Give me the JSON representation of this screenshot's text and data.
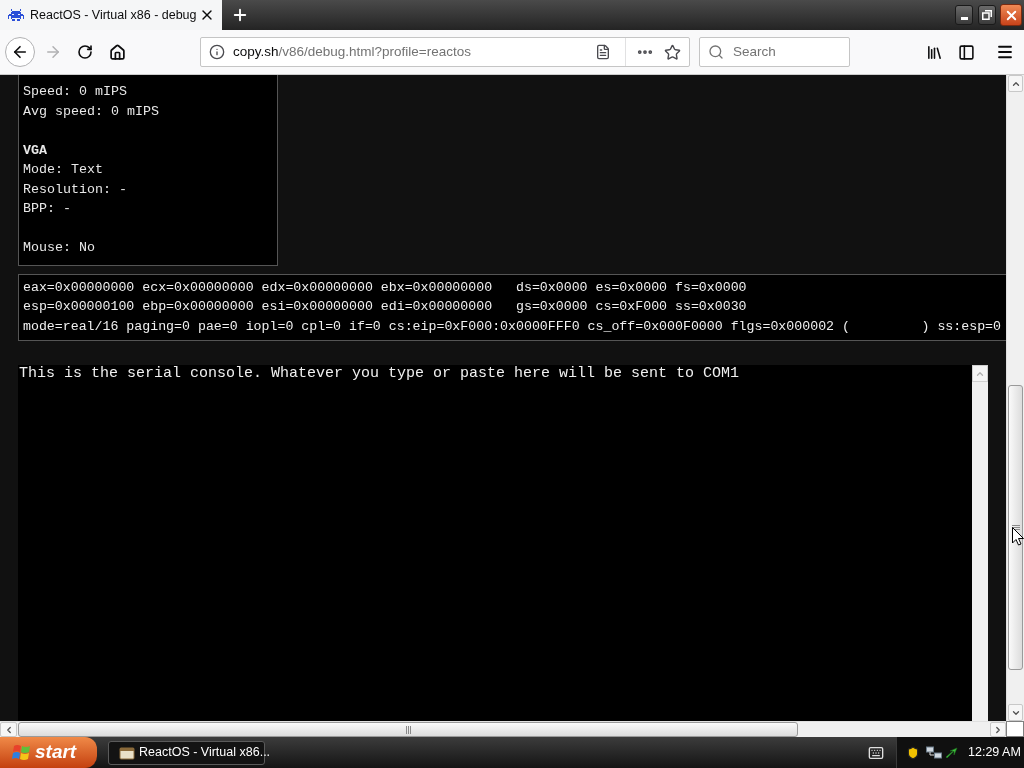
{
  "browser": {
    "tabs": [
      {
        "title": "ReactOS - Virtual x86 - debug",
        "selected": true
      }
    ],
    "back": {
      "disabled": false
    },
    "forward": {
      "disabled": true
    },
    "address_bar": {
      "host": "copy.sh",
      "path": "/v86/debug.html?profile=reactos"
    },
    "search": {
      "placeholder": "Search"
    }
  },
  "info_panel": {
    "groups": [
      {
        "lines": [
          "Speed: 0 mIPS",
          "Avg speed: 0 mIPS"
        ]
      },
      {
        "heading": "VGA",
        "lines": [
          "Mode: Text",
          "Resolution: -",
          "BPP: -"
        ]
      },
      {
        "lines": [
          "Mouse: No"
        ]
      }
    ]
  },
  "registers": {
    "lines": [
      "eax=0x00000000 ecx=0x00000000 edx=0x00000000 ebx=0x00000000   ds=0x0000 es=0x0000 fs=0x0000",
      "esp=0x00000100 ebp=0x00000000 esi=0x00000000 edi=0x00000000   gs=0x0000 cs=0xF000 ss=0x0030",
      "mode=real/16 paging=0 pae=0 iopl=0 cpl=0 if=0 cs:eip=0xF000:0x0000FFF0 cs_off=0x000F0000 flgs=0x000002 (         ) ss:esp=0"
    ]
  },
  "serial_console": {
    "value": "This is the serial console. Whatever you type or paste here will be sent to COM1"
  },
  "taskbar": {
    "start": "start",
    "windows": [
      {
        "title": "ReactOS - Virtual x86...",
        "selected": true
      }
    ],
    "clock": "12:29 AM"
  }
}
